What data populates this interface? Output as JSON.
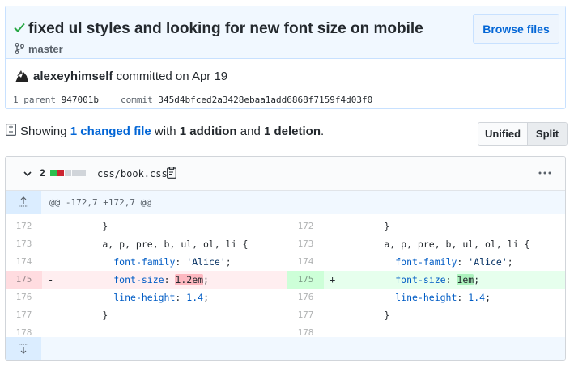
{
  "commit": {
    "title": "fixed ul styles and looking for new font size on mobile",
    "branch": "master",
    "browse_label": "Browse files",
    "author": "alexeyhimself",
    "committed_text": " committed on Apr 19",
    "parent_label": "1 parent ",
    "parent_sha": "947001b",
    "commit_label": "commit ",
    "commit_sha": "345d4bfced2a3428ebaa1add6868f7159f4d03f0"
  },
  "summary": {
    "prefix": "Showing ",
    "changed": "1 changed file",
    "with": " with ",
    "additions": "1 addition",
    "and": " and ",
    "deletions": "1 deletion",
    "suffix": ".",
    "unified_label": "Unified",
    "split_label": "Split"
  },
  "file": {
    "count": "2",
    "name": "css/book.css",
    "diffstat_colors": [
      "#2cbe4e",
      "#cb2431",
      "#d1d5da",
      "#d1d5da",
      "#d1d5da"
    ],
    "hunk": "@@ -172,7 +172,7 @@",
    "rows": [
      {
        "ln": "172",
        "lt": "        }",
        "rn": "172",
        "rt": "        }"
      },
      {
        "ln": "173",
        "lt": "        a, p, pre, b, ul, ol, li {",
        "rn": "173",
        "rt": "        a, p, pre, b, ul, ol, li {"
      },
      {
        "ln": "174",
        "lt": "          font-family: 'Alice';",
        "rn": "174",
        "rt": "          font-family: 'Alice';"
      },
      {
        "ln": "175",
        "lt": "          font-size: 1.2em;",
        "rn": "175",
        "rt": "          font-size: 1em;"
      },
      {
        "ln": "176",
        "lt": "          line-height: 1.4;",
        "rn": "176",
        "rt": "          line-height: 1.4;"
      },
      {
        "ln": "177",
        "lt": "        }",
        "rn": "177",
        "rt": "        }"
      },
      {
        "ln": "178",
        "lt": "",
        "rn": "178",
        "rt": ""
      }
    ],
    "del_marker": "-",
    "add_marker": "+"
  }
}
